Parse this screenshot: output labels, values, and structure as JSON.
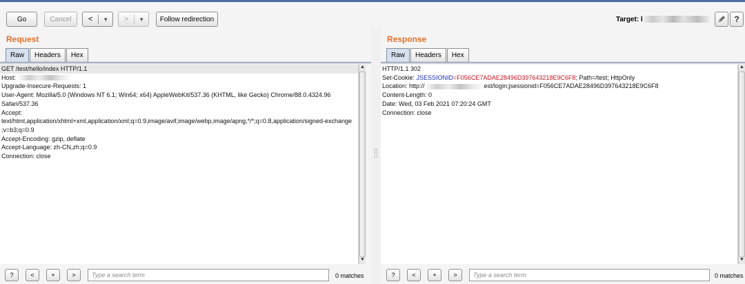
{
  "toolbar": {
    "go_label": "Go",
    "cancel_label": "Cancel",
    "back_arrow": "<",
    "forward_arrow": ">",
    "dropdown_glyph": "▼",
    "follow_label": "Follow redirection",
    "target_label": "Target: ht",
    "edit_icon": "pencil-icon",
    "help_label": "?"
  },
  "request": {
    "title": "Request",
    "tabs": [
      "Raw",
      "Headers",
      "Hex"
    ],
    "lines": [
      "GET /test/hello/index HTTP/1.1",
      "Host: ",
      "Upgrade-Insecure-Requests: 1",
      "User-Agent: Mozilla/5.0 (Windows NT 6.1; Win64; x64) AppleWebKit/537.36 (KHTML, like Gecko) Chrome/88.0.4324.96",
      "Safari/537.36",
      "Accept:",
      "text/html,application/xhtml+xml,application/xml;q=0.9,image/avif,image/webp,image/apng,*/*;q=0.8,application/signed-exchange",
      ";v=b3;q=0.9",
      "Accept-Encoding: gzip, deflate",
      "Accept-Language: zh-CN,zh;q=0.9",
      "Connection: close"
    ]
  },
  "response": {
    "title": "Response",
    "tabs": [
      "Raw",
      "Headers",
      "Hex"
    ],
    "status_line": "HTTP/1.1 302",
    "cookie_prefix": "Set-Cookie: ",
    "cookie_name": "JSESSIONID",
    "cookie_value": "=F056CE7ADAE28496D397643218E9C6F8",
    "cookie_suffix": "; Path=/test; HttpOnly",
    "location_prefix": "Location: http://",
    "location_suffix": "est/login;jsessionid=F056CE7ADAE28496D397643218E9C6F8",
    "content_length": "Content-Length: 0",
    "date": "Date: Wed, 03 Feb 2021 07:20:24 GMT",
    "connection": "Connection: close"
  },
  "search": {
    "help": "?",
    "prev": "<",
    "add": "+",
    "next": ">",
    "placeholder": "Type a search term",
    "request_matches": "0 matches",
    "response_matches": "0 matches"
  },
  "colors": {
    "title_orange": "#e5702a",
    "cookie_name_blue": "#1d2bb8",
    "cookie_value_red": "#c4141c"
  }
}
